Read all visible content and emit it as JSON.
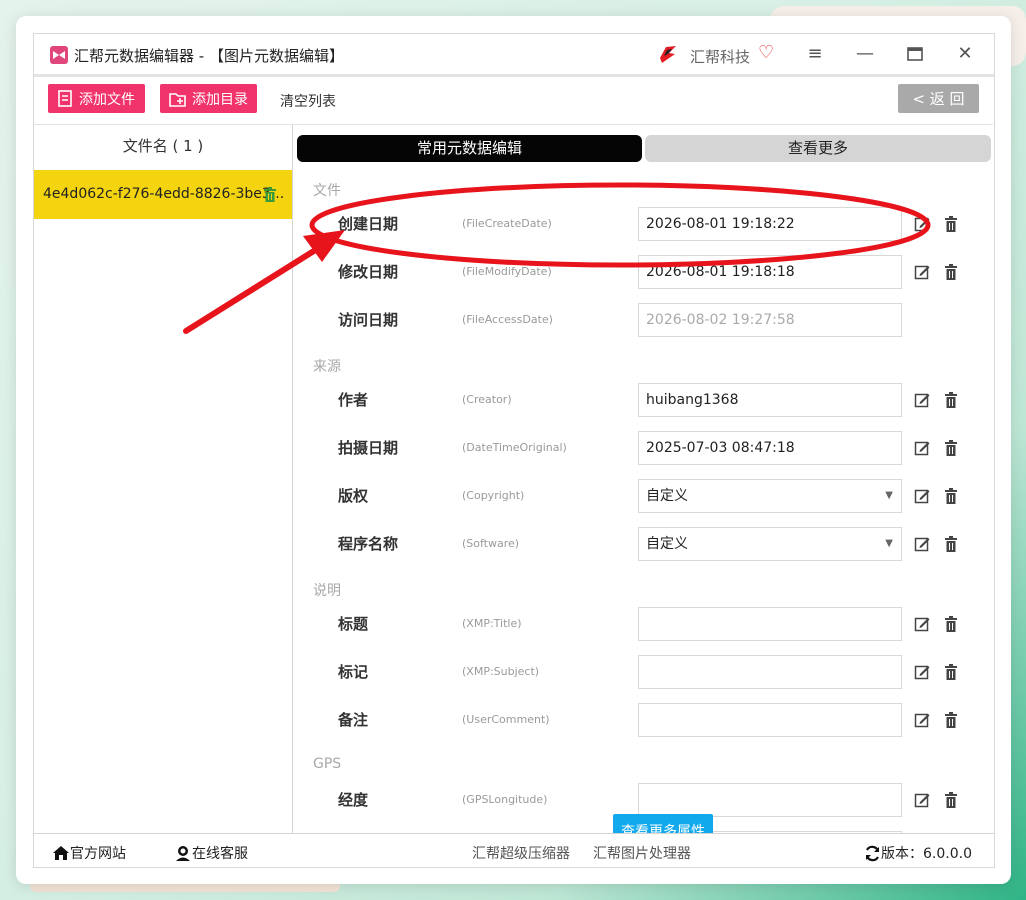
{
  "window": {
    "title": "汇帮元数据编辑器 - 【图片元数据编辑】",
    "brand": "汇帮科技",
    "menu_icon": "hamburger-icon",
    "minimize_icon": "minimize-icon",
    "maximize_icon": "maximize-icon",
    "close_icon": "close-icon"
  },
  "toolbar": {
    "add_file": "添加文件",
    "add_dir": "添加目录",
    "clear": "清空列表",
    "back": "< 返 回"
  },
  "file_panel": {
    "header": "文件名 ( 1 )",
    "files": [
      "4e4d062c-f276-4edd-8826-3be3..."
    ]
  },
  "tabs": {
    "common": "常用元数据编辑",
    "more": "查看更多"
  },
  "sections": {
    "file": "文件",
    "source": "来源",
    "desc": "说明",
    "gps": "GPS"
  },
  "fields": [
    {
      "label": "创建日期",
      "key": "(FileCreateDate)",
      "value": "2026-08-01 19:18:22"
    },
    {
      "label": "修改日期",
      "key": "(FileModifyDate)",
      "value": "2026-08-01 19:18:18"
    },
    {
      "label": "访问日期",
      "key": "(FileAccessDate)",
      "value": "2026-08-02 19:27:58"
    },
    {
      "label": "作者",
      "key": "(Creator)",
      "value": "huibang1368"
    },
    {
      "label": "拍摄日期",
      "key": "(DateTimeOriginal)",
      "value": "2025-07-03 08:47:18"
    },
    {
      "label": "版权",
      "key": "(Copyright)",
      "value": "自定义"
    },
    {
      "label": "程序名称",
      "key": "(Software)",
      "value": "自定义"
    },
    {
      "label": "标题",
      "key": "(XMP:Title)",
      "value": ""
    },
    {
      "label": "标记",
      "key": "(XMP:Subject)",
      "value": ""
    },
    {
      "label": "备注",
      "key": "(UserComment)",
      "value": ""
    },
    {
      "label": "经度",
      "key": "(GPSLongitude)",
      "value": ""
    }
  ],
  "more_button": "查看更多属性",
  "footer": {
    "website": "官方网站",
    "support": "在线客服",
    "compressor": "汇帮超级压缩器",
    "image_tool": "汇帮图片处理器",
    "version": "版本：6.0.0.0"
  },
  "colors": {
    "accent_pink": "#f0336a",
    "selected_file": "#f3d40f",
    "more_button": "#11a9ec",
    "annotation_red": "#e8141c"
  }
}
